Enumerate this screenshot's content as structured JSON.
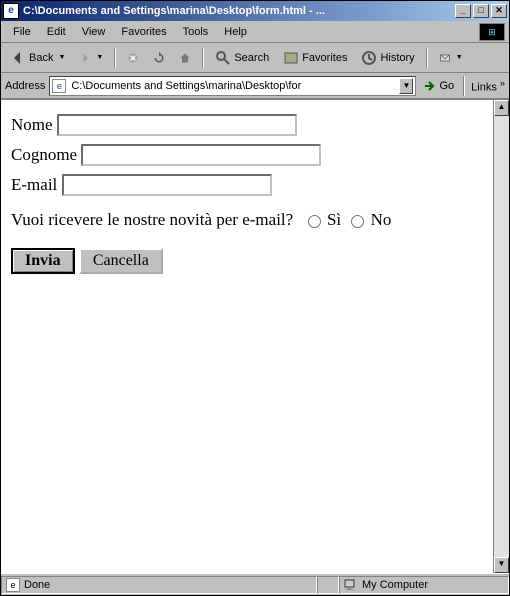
{
  "title": "C:\\Documents and Settings\\marina\\Desktop\\form.html - ...",
  "menu": [
    "File",
    "Edit",
    "View",
    "Favorites",
    "Tools",
    "Help"
  ],
  "toolbar": {
    "back": "Back",
    "search": "Search",
    "favorites": "Favorites",
    "history": "History"
  },
  "address": {
    "label": "Address",
    "value": "C:\\Documents and Settings\\marina\\Desktop\\for",
    "go": "Go",
    "links": "Links"
  },
  "form": {
    "nome_label": "Nome",
    "cognome_label": "Cognome",
    "email_label": "E-mail",
    "question": "Vuoi ricevere le nostre novità per e-mail?",
    "si": "Sì",
    "no": "No",
    "submit": "Invia",
    "reset": "Cancella"
  },
  "status": {
    "text": "Done",
    "zone": "My Computer"
  }
}
